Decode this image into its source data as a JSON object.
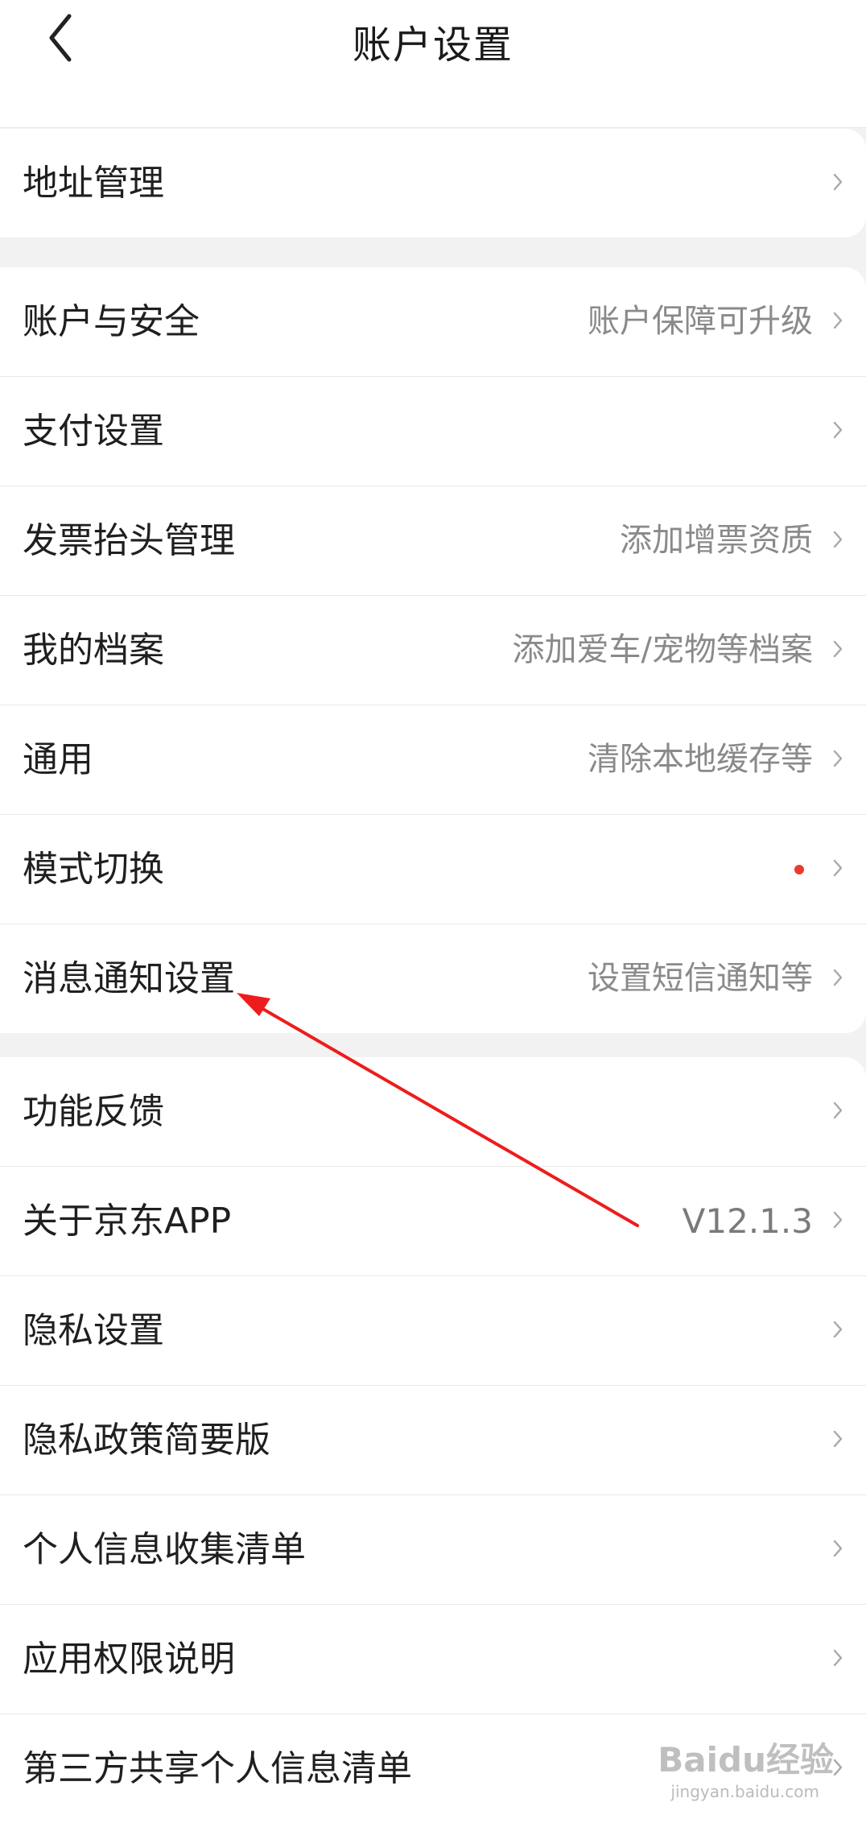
{
  "header": {
    "title": "账户设置",
    "back_icon": "chevron-left-icon"
  },
  "group1": [
    {
      "label": "地址管理",
      "value": ""
    }
  ],
  "group2": [
    {
      "label": "账户与安全",
      "value": "账户保障可升级"
    },
    {
      "label": "支付设置",
      "value": ""
    },
    {
      "label": "发票抬头管理",
      "value": "添加增票资质"
    },
    {
      "label": "我的档案",
      "value": "添加爱车/宠物等档案"
    },
    {
      "label": "通用",
      "value": "清除本地缓存等"
    },
    {
      "label": "模式切换",
      "value": "",
      "badge": "red-dot"
    },
    {
      "label": "消息通知设置",
      "value": "设置短信通知等"
    }
  ],
  "group3": [
    {
      "label": "功能反馈",
      "value": ""
    },
    {
      "label": "关于京东APP",
      "value": "V12.1.3"
    },
    {
      "label": "隐私设置",
      "value": ""
    },
    {
      "label": "隐私政策简要版",
      "value": ""
    },
    {
      "label": "个人信息收集清单",
      "value": ""
    },
    {
      "label": "应用权限说明",
      "value": ""
    },
    {
      "label": "第三方共享个人信息清单",
      "value": ""
    }
  ],
  "watermark": {
    "brand": "Baidu经验",
    "url": "jingyan.baidu.com"
  },
  "colors": {
    "accent_red": "#e93b2f",
    "annotation_arrow": "#ee1c1c",
    "chevron": "#a8a8a8"
  }
}
